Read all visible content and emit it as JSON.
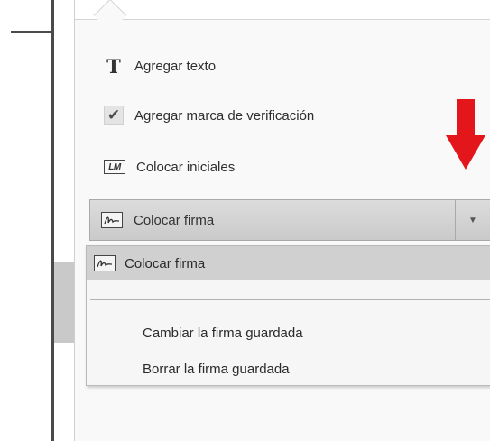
{
  "menu": {
    "items": [
      {
        "label": "Agregar texto",
        "icon": "text-T-icon"
      },
      {
        "label": "Agregar marca de verificación",
        "icon": "checkmark-icon"
      },
      {
        "label": "Colocar iniciales",
        "icon": "initials-icon"
      }
    ]
  },
  "initials_icon_text": "LM",
  "combo": {
    "label": "Colocar firma",
    "icon": "signature-icon",
    "arrow_icon": "chevron-down-icon"
  },
  "dropdown": {
    "selected_label": "Colocar firma",
    "options": [
      "Cambiar la firma guardada",
      "Borrar la firma guardada"
    ]
  },
  "colors": {
    "annotation_arrow": "#e3161b",
    "dropdown_selected_bg": "#d0d0d0"
  }
}
